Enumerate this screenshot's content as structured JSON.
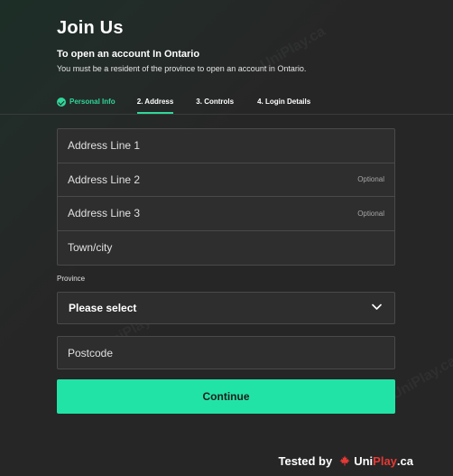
{
  "header": {
    "title": "Join Us",
    "subtitle": "To open an account In Ontario",
    "description": "You must be a resident of the province to open an account in Ontario."
  },
  "steps": [
    {
      "label": "Personal Info",
      "state": "completed"
    },
    {
      "label": "2. Address",
      "state": "active"
    },
    {
      "label": "3. Controls",
      "state": "upcoming"
    },
    {
      "label": "4. Login Details",
      "state": "upcoming"
    }
  ],
  "address": {
    "line1": {
      "placeholder": "Address Line 1"
    },
    "line2": {
      "placeholder": "Address Line 2",
      "hint": "Optional"
    },
    "line3": {
      "placeholder": "Address Line 3",
      "hint": "Optional"
    },
    "town": {
      "placeholder": "Town/city"
    }
  },
  "province": {
    "label": "Province",
    "selected": "Please select"
  },
  "postcode": {
    "placeholder": "Postcode"
  },
  "continue_label": "Continue",
  "footer": {
    "tested_by": "Tested by",
    "brand_uni": "Uni",
    "brand_play": "Play",
    "brand_tld": ".ca"
  },
  "watermarks": [
    "UniPlay.ca",
    "UniPlay.ca",
    "UniPlay.ca"
  ],
  "colors": {
    "accent": "#22e3a6",
    "step_complete": "#2fd79a",
    "background": "#262626",
    "field_background": "#2e2e2e",
    "brand_red": "#e53935"
  }
}
